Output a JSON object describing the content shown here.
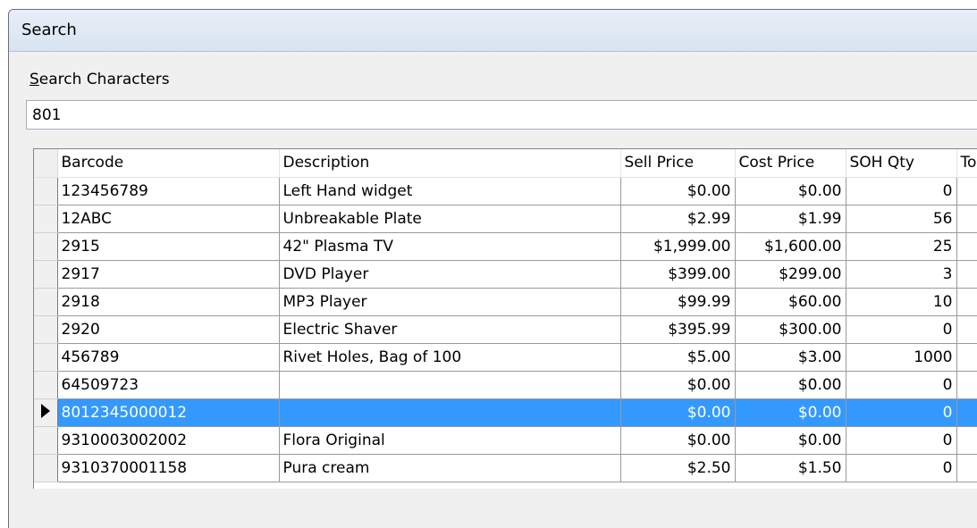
{
  "window": {
    "title": "Search"
  },
  "search": {
    "label_mnemonic": "S",
    "label_rest": "earch Characters",
    "value": "801"
  },
  "grid": {
    "columns": [
      "Barcode",
      "Description",
      "Sell Price",
      "Cost Price",
      "SOH Qty",
      "To"
    ],
    "rows": [
      {
        "barcode": "123456789",
        "description": "Left Hand widget",
        "sell": "$0.00",
        "cost": "$0.00",
        "soh": "0"
      },
      {
        "barcode": "12ABC",
        "description": "Unbreakable Plate",
        "sell": "$2.99",
        "cost": "$1.99",
        "soh": "56"
      },
      {
        "barcode": "2915",
        "description": "42\" Plasma TV",
        "sell": "$1,999.00",
        "cost": "$1,600.00",
        "soh": "25"
      },
      {
        "barcode": "2917",
        "description": "DVD Player",
        "sell": "$399.00",
        "cost": "$299.00",
        "soh": "3"
      },
      {
        "barcode": "2918",
        "description": "MP3 Player",
        "sell": "$99.99",
        "cost": "$60.00",
        "soh": "10"
      },
      {
        "barcode": "2920",
        "description": "Electric Shaver",
        "sell": "$395.99",
        "cost": "$300.00",
        "soh": "0"
      },
      {
        "barcode": "456789",
        "description": "Rivet Holes, Bag of 100",
        "sell": "$5.00",
        "cost": "$3.00",
        "soh": "1000"
      },
      {
        "barcode": "64509723",
        "description": "",
        "sell": "$0.00",
        "cost": "$0.00",
        "soh": "0"
      },
      {
        "barcode": "8012345000012",
        "description": "",
        "sell": "$0.00",
        "cost": "$0.00",
        "soh": "0"
      },
      {
        "barcode": "9310003002002",
        "description": "Flora Original",
        "sell": "$0.00",
        "cost": "$0.00",
        "soh": "0"
      },
      {
        "barcode": "9310370001158",
        "description": "Pura cream",
        "sell": "$2.50",
        "cost": "$1.50",
        "soh": "0"
      }
    ],
    "selected_index": 8
  }
}
